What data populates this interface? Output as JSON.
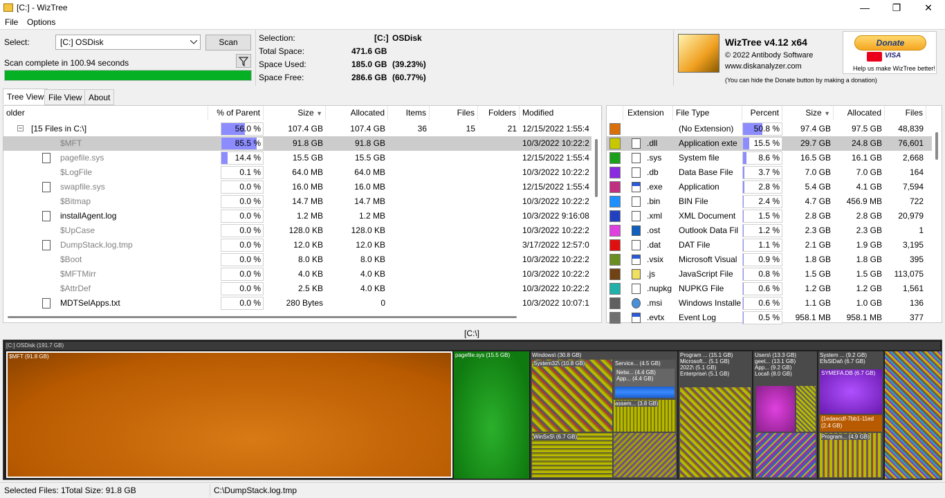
{
  "window": {
    "title": "[C:]  - WizTree",
    "minimize": "—",
    "maximize": "❐",
    "close": "✕"
  },
  "menu": {
    "file": "File",
    "options": "Options"
  },
  "scan": {
    "select_label": "Select:",
    "drive": "[C:] OSDisk",
    "scan_button": "Scan",
    "status": "Scan complete in 100.94 seconds",
    "progress": 1.0
  },
  "summary": {
    "selection_label": "Selection:",
    "selection_drive": "[C:]",
    "selection_name": "OSDisk",
    "total_label": "Total Space:",
    "total_value": "471.6 GB",
    "used_label": "Space Used:",
    "used_value": "185.0 GB",
    "used_pct": "(39.23%)",
    "free_label": "Space Free:",
    "free_value": "286.6 GB",
    "free_pct": "(60.77%)"
  },
  "about": {
    "name": "WizTree v4.12 x64",
    "copyright": "© 2022 Antibody Software",
    "site": "www.diskanalyzer.com",
    "note": "(You can hide the Donate button by making a donation)"
  },
  "donate": {
    "label": "Donate",
    "visa": "VISA",
    "help": "Help us make WizTree better!"
  },
  "tabs": [
    "Tree View",
    "File View",
    "About"
  ],
  "tree": {
    "headers": {
      "folder": "older",
      "pct": "% of Parent",
      "size": "Size",
      "allocated": "Allocated",
      "items": "Items",
      "files": "Files",
      "folders": "Folders",
      "modified": "Modified"
    },
    "rows": [
      {
        "name": "[15 Files in C:\\]",
        "pct": 56.0,
        "pct_text": "56.0 %",
        "size": "107.4 GB",
        "allocated": "107.4 GB",
        "items": "36",
        "files": "15",
        "folders": "21",
        "modified": "12/15/2022 1:55:4",
        "grey": false,
        "icon": "folder-expand"
      },
      {
        "name": "$MFT",
        "pct": 85.5,
        "pct_text": "85.5 %",
        "size": "91.8 GB",
        "allocated": "91.8 GB",
        "items": "",
        "files": "",
        "folders": "",
        "modified": "10/3/2022 10:22:2",
        "grey": true,
        "icon": "none"
      },
      {
        "name": "pagefile.sys",
        "pct": 14.4,
        "pct_text": "14.4 %",
        "size": "15.5 GB",
        "allocated": "15.5 GB",
        "items": "",
        "files": "",
        "folders": "",
        "modified": "12/15/2022 1:55:4",
        "grey": true,
        "icon": "sysfile"
      },
      {
        "name": "$LogFile",
        "pct": 0.1,
        "pct_text": "0.1 %",
        "size": "64.0 MB",
        "allocated": "64.0 MB",
        "items": "",
        "files": "",
        "folders": "",
        "modified": "10/3/2022 10:22:2",
        "grey": true,
        "icon": "none"
      },
      {
        "name": "swapfile.sys",
        "pct": 0.0,
        "pct_text": "0.0 %",
        "size": "16.0 MB",
        "allocated": "16.0 MB",
        "items": "",
        "files": "",
        "folders": "",
        "modified": "12/15/2022 1:55:4",
        "grey": true,
        "icon": "sysfile"
      },
      {
        "name": "$Bitmap",
        "pct": 0.0,
        "pct_text": "0.0 %",
        "size": "14.7 MB",
        "allocated": "14.7 MB",
        "items": "",
        "files": "",
        "folders": "",
        "modified": "10/3/2022 10:22:2",
        "grey": true,
        "icon": "none"
      },
      {
        "name": "installAgent.log",
        "pct": 0.0,
        "pct_text": "0.0 %",
        "size": "1.2 MB",
        "allocated": "1.2 MB",
        "items": "",
        "files": "",
        "folders": "",
        "modified": "10/3/2022 9:16:08",
        "grey": false,
        "icon": "file"
      },
      {
        "name": "$UpCase",
        "pct": 0.0,
        "pct_text": "0.0 %",
        "size": "128.0 KB",
        "allocated": "128.0 KB",
        "items": "",
        "files": "",
        "folders": "",
        "modified": "10/3/2022 10:22:2",
        "grey": true,
        "icon": "none"
      },
      {
        "name": "DumpStack.log.tmp",
        "pct": 0.0,
        "pct_text": "0.0 %",
        "size": "12.0 KB",
        "allocated": "12.0 KB",
        "items": "",
        "files": "",
        "folders": "",
        "modified": "3/17/2022 12:57:0",
        "grey": true,
        "icon": "file"
      },
      {
        "name": "$Boot",
        "pct": 0.0,
        "pct_text": "0.0 %",
        "size": "8.0 KB",
        "allocated": "8.0 KB",
        "items": "",
        "files": "",
        "folders": "",
        "modified": "10/3/2022 10:22:2",
        "grey": true,
        "icon": "none"
      },
      {
        "name": "$MFTMirr",
        "pct": 0.0,
        "pct_text": "0.0 %",
        "size": "4.0 KB",
        "allocated": "4.0 KB",
        "items": "",
        "files": "",
        "folders": "",
        "modified": "10/3/2022 10:22:2",
        "grey": true,
        "icon": "none"
      },
      {
        "name": "$AttrDef",
        "pct": 0.0,
        "pct_text": "0.0 %",
        "size": "2.5 KB",
        "allocated": "4.0 KB",
        "items": "",
        "files": "",
        "folders": "",
        "modified": "10/3/2022 10:22:2",
        "grey": true,
        "icon": "none"
      },
      {
        "name": "MDTSelApps.txt",
        "pct": 0.0,
        "pct_text": "0.0 %",
        "size": "280 Bytes",
        "allocated": "0",
        "items": "",
        "files": "",
        "folders": "",
        "modified": "10/3/2022 10:07:1",
        "grey": false,
        "icon": "file"
      }
    ]
  },
  "extensions": {
    "headers": {
      "ext": "Extension",
      "type": "File Type",
      "pct": "Percent",
      "size": "Size",
      "allocated": "Allocated",
      "files": "Files"
    },
    "rows": [
      {
        "color": "#d9700c",
        "ext": "",
        "type": "(No Extension)",
        "pct": 50.8,
        "pct_text": "50.8 %",
        "size": "97.4 GB",
        "allocated": "97.5 GB",
        "files": "48,839",
        "icon": "none"
      },
      {
        "color": "#c8c800",
        "ext": ".dll",
        "type": "Application exte",
        "pct": 15.5,
        "pct_text": "15.5 %",
        "size": "29.7 GB",
        "allocated": "24.8 GB",
        "files": "76,601",
        "icon": "gear"
      },
      {
        "color": "#1aa01a",
        "ext": ".sys",
        "type": "System file",
        "pct": 8.6,
        "pct_text": "8.6 %",
        "size": "16.5 GB",
        "allocated": "16.1 GB",
        "files": "2,668",
        "icon": "gear"
      },
      {
        "color": "#8a2be2",
        "ext": ".db",
        "type": "Data Base File",
        "pct": 3.7,
        "pct_text": "3.7 %",
        "size": "7.0 GB",
        "allocated": "7.0 GB",
        "files": "164",
        "icon": "file"
      },
      {
        "color": "#c03080",
        "ext": ".exe",
        "type": "Application",
        "pct": 2.8,
        "pct_text": "2.8 %",
        "size": "5.4 GB",
        "allocated": "4.1 GB",
        "files": "7,594",
        "icon": "app"
      },
      {
        "color": "#1e90ff",
        "ext": ".bin",
        "type": "BIN File",
        "pct": 2.4,
        "pct_text": "2.4 %",
        "size": "4.7 GB",
        "allocated": "456.9 MB",
        "files": "722",
        "icon": "file"
      },
      {
        "color": "#2040c0",
        "ext": ".xml",
        "type": "XML Document",
        "pct": 1.5,
        "pct_text": "1.5 %",
        "size": "2.8 GB",
        "allocated": "2.8 GB",
        "files": "20,979",
        "icon": "file"
      },
      {
        "color": "#e040e0",
        "ext": ".ost",
        "type": "Outlook Data Fil",
        "pct": 1.2,
        "pct_text": "1.2 %",
        "size": "2.3 GB",
        "allocated": "2.3 GB",
        "files": "1",
        "icon": "outlook"
      },
      {
        "color": "#e01010",
        "ext": ".dat",
        "type": "DAT File",
        "pct": 1.1,
        "pct_text": "1.1 %",
        "size": "2.1 GB",
        "allocated": "1.9 GB",
        "files": "3,195",
        "icon": "file"
      },
      {
        "color": "#6b8e23",
        "ext": ".vsix",
        "type": "Microsoft Visual",
        "pct": 0.9,
        "pct_text": "0.9 %",
        "size": "1.8 GB",
        "allocated": "1.8 GB",
        "files": "395",
        "icon": "app"
      },
      {
        "color": "#704214",
        "ext": ".js",
        "type": "JavaScript File",
        "pct": 0.8,
        "pct_text": "0.8 %",
        "size": "1.5 GB",
        "allocated": "1.5 GB",
        "files": "113,075",
        "icon": "script"
      },
      {
        "color": "#20b2aa",
        "ext": ".nupkg",
        "type": "NUPKG File",
        "pct": 0.6,
        "pct_text": "0.6 %",
        "size": "1.2 GB",
        "allocated": "1.2 GB",
        "files": "1,561",
        "icon": "file"
      },
      {
        "color": "#606060",
        "ext": ".msi",
        "type": "Windows Installe",
        "pct": 0.6,
        "pct_text": "0.6 %",
        "size": "1.1 GB",
        "allocated": "1.0 GB",
        "files": "136",
        "icon": "disc"
      },
      {
        "color": "#707070",
        "ext": ".evtx",
        "type": "Event Log",
        "pct": 0.5,
        "pct_text": "0.5 %",
        "size": "958.1 MB",
        "allocated": "958.1 MB",
        "files": "377",
        "icon": "app"
      }
    ]
  },
  "treemap": {
    "path": "[C:\\]",
    "root": "[C:] OSDisk  (191.7 GB)",
    "mft": "$MFT (91.8 GB)",
    "pagefile": "pagefile.sys (15.5 GB)",
    "windows": "Windows\\ (30.8 GB)",
    "system32": "System32\\ (10.8 GB)",
    "service": "Service... (4.5 GB)",
    "netw": "Netw... (4.4 GB)",
    "app": "App... (4.4 GB)",
    "assem": "assem... (3.8 GB)",
    "winsxs": "WinSxS\\ (6.7 GB)",
    "program1": "Program ... (15.1 GB)",
    "microsoft": "Microsoft... (5.1 GB)",
    "y2022": "2022\\ (5.1 GB)",
    "enterprise": "Enterprise\\ (5.1 GB)",
    "users": "Users\\ (13.3 GB)",
    "geet": "geet... (13.1 GB)",
    "appu": "App... (9.2 GB)",
    "local": "Local\\ (8.0 GB)",
    "system": "System ... (9.2 GB)",
    "efs": "EfsSlDat\\ (6.7 GB)",
    "symefa": "SYMEFA.DB (6.7 GB)",
    "guid": "{1edaecdf-7bb1-11ed",
    "guid_size": "(2.4 GB)",
    "program2": "Program... (4.9 GB)"
  },
  "status": {
    "selected": "Selected Files: 1",
    "total": "Total Size: 91.8 GB",
    "path": "C:\\DumpStack.log.tmp"
  }
}
